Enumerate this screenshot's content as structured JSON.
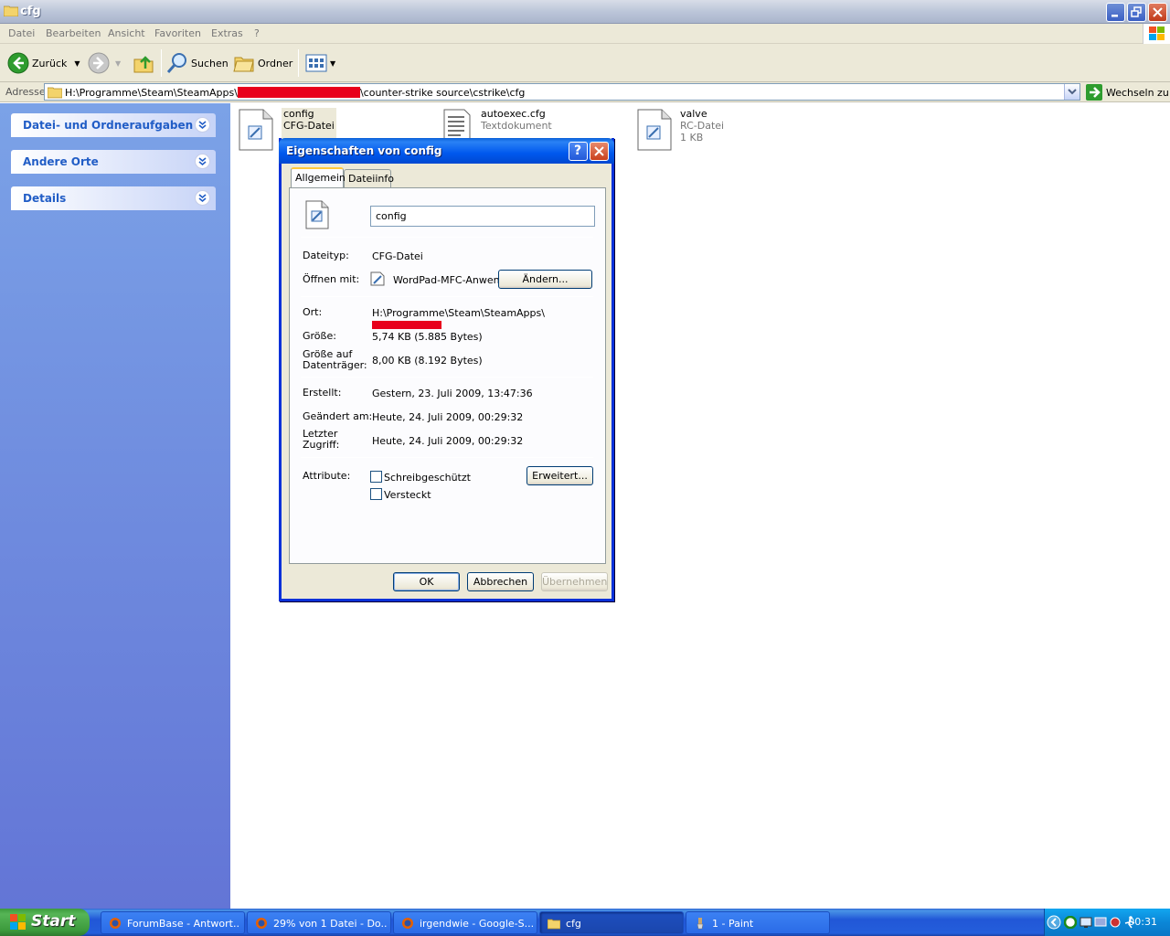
{
  "window": {
    "title": "cfg"
  },
  "menu": {
    "items": [
      "Datei",
      "Bearbeiten",
      "Ansicht",
      "Favoriten",
      "Extras",
      "?"
    ]
  },
  "toolbar": {
    "back": "Zurück",
    "search": "Suchen",
    "folders": "Ordner"
  },
  "address": {
    "label": "Adresse",
    "path_start": "H:\\Programme\\Steam\\SteamApps\\",
    "path_end": "\\counter-strike source\\cstrike\\cfg",
    "go": "Wechseln zu"
  },
  "sidebar": {
    "panels": [
      {
        "label": "Datei- und Ordneraufgaben"
      },
      {
        "label": "Andere Orte"
      },
      {
        "label": "Details"
      }
    ]
  },
  "files": [
    {
      "name": "config",
      "type": "CFG-Datei",
      "size": ""
    },
    {
      "name": "autoexec.cfg",
      "type": "Textdokument",
      "size": ""
    },
    {
      "name": "valve",
      "type": "RC-Datei",
      "size": "1 KB"
    }
  ],
  "dialog": {
    "title": "Eigenschaften von config",
    "tabs": [
      "Allgemein",
      "Dateiinfo"
    ],
    "filename": "config",
    "type_label": "Dateityp:",
    "type_value": "CFG-Datei",
    "open_label": "Öffnen mit:",
    "open_value": "WordPad-MFC-Anwen",
    "change_button": "Ändern...",
    "location_label": "Ort:",
    "location_value": "H:\\Programme\\Steam\\SteamApps\\",
    "size_label": "Größe:",
    "size_value": "5,74 KB (5.885 Bytes)",
    "disk_size_label_1": "Größe auf",
    "disk_size_label_2": "Datenträger:",
    "disk_size_value": "8,00 KB (8.192 Bytes)",
    "created_label": "Erstellt:",
    "created_value": "Gestern, 23. Juli 2009, 13:47:36",
    "modified_label": "Geändert am:",
    "modified_value": "Heute, 24. Juli 2009, 00:29:32",
    "accessed_label_1": "Letzter",
    "accessed_label_2": "Zugriff:",
    "accessed_value": "Heute, 24. Juli 2009, 00:29:32",
    "attributes_label": "Attribute:",
    "readonly_label": "Schreibgeschützt",
    "hidden_label": "Versteckt",
    "advanced_button": "Erweitert...",
    "ok_button": "OK",
    "cancel_button": "Abbrechen",
    "apply_button": "Übernehmen"
  },
  "taskbar": {
    "start": "Start",
    "tasks": [
      {
        "label": "ForumBase - Antwort..."
      },
      {
        "label": "29% von 1 Datei - Do..."
      },
      {
        "label": "irgendwie - Google-S..."
      },
      {
        "label": "cfg"
      },
      {
        "label": "1 - Paint"
      }
    ],
    "clock": "00:31"
  }
}
